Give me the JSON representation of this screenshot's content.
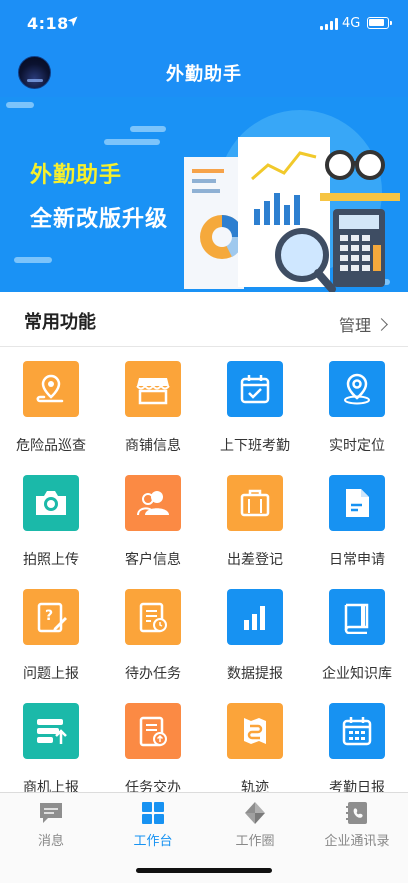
{
  "status_bar": {
    "time": "4:18",
    "network": "4G"
  },
  "header": {
    "title": "外勤助手"
  },
  "banner": {
    "line1": "外勤助手",
    "line2": "全新改版升级"
  },
  "section": {
    "title": "常用功能",
    "manage_label": "管理"
  },
  "functions": [
    {
      "label": "危险品巡查",
      "icon": "map-pin-route-icon",
      "color": "#fba43a"
    },
    {
      "label": "商铺信息",
      "icon": "store-icon",
      "color": "#fba43a"
    },
    {
      "label": "上下班考勤",
      "icon": "calendar-check-icon",
      "color": "#1792f2"
    },
    {
      "label": "实时定位",
      "icon": "location-pin-icon",
      "color": "#1792f2"
    },
    {
      "label": "拍照上传",
      "icon": "camera-icon",
      "color": "#1bb9a9"
    },
    {
      "label": "客户信息",
      "icon": "contacts-icon",
      "color": "#fb8a44"
    },
    {
      "label": "出差登记",
      "icon": "briefcase-icon",
      "color": "#fba43a"
    },
    {
      "label": "日常申请",
      "icon": "document-icon",
      "color": "#1792f2"
    },
    {
      "label": "问题上报",
      "icon": "question-edit-icon",
      "color": "#fba43a"
    },
    {
      "label": "待办任务",
      "icon": "task-clock-icon",
      "color": "#fba43a"
    },
    {
      "label": "数据提报",
      "icon": "bar-chart-icon",
      "color": "#1792f2"
    },
    {
      "label": "企业知识库",
      "icon": "book-icon",
      "color": "#1792f2"
    },
    {
      "label": "商机上报",
      "icon": "upload-list-icon",
      "color": "#1bb9a9"
    },
    {
      "label": "任务交办",
      "icon": "task-assign-icon",
      "color": "#fb8a44"
    },
    {
      "label": "轨迹",
      "icon": "route-icon",
      "color": "#fba43a"
    },
    {
      "label": "考勤日报",
      "icon": "calendar-grid-icon",
      "color": "#1792f2"
    }
  ],
  "tabs": [
    {
      "label": "消息",
      "icon": "message-icon",
      "active": false
    },
    {
      "label": "工作台",
      "icon": "grid-icon",
      "active": true
    },
    {
      "label": "工作圈",
      "icon": "circle-diamond-icon",
      "active": false
    },
    {
      "label": "企业通讯录",
      "icon": "address-book-icon",
      "active": false
    }
  ]
}
